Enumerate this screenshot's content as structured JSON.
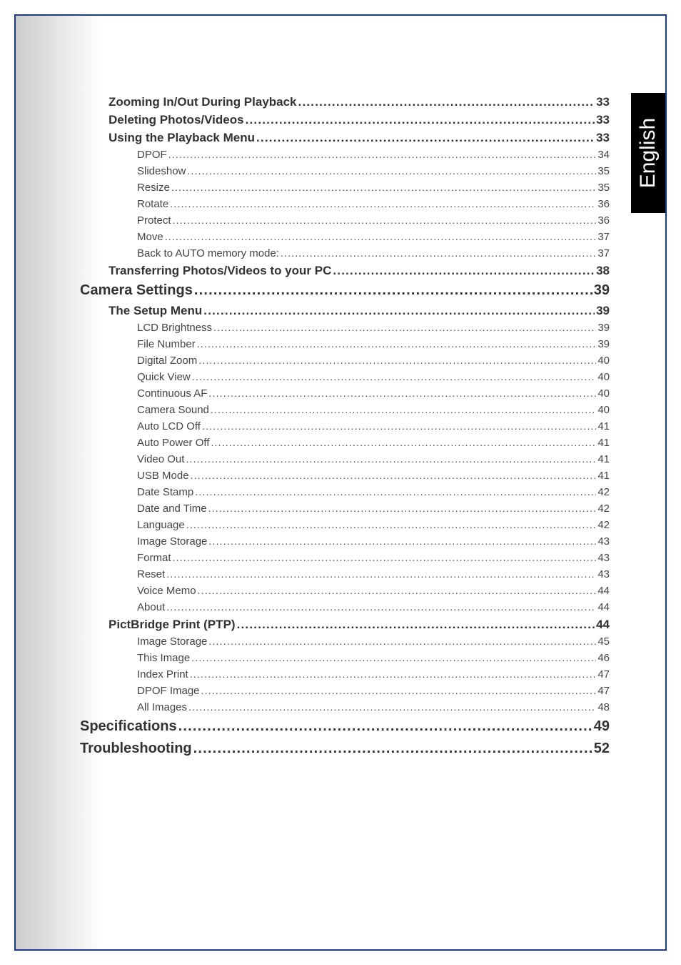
{
  "language_tab": "English",
  "toc": [
    {
      "level": 2,
      "title": "Zooming In/Out During Playback",
      "page": "33"
    },
    {
      "level": 2,
      "title": "Deleting Photos/Videos",
      "page": "33"
    },
    {
      "level": 2,
      "title": "Using the Playback Menu",
      "page": "33"
    },
    {
      "level": 3,
      "title": "DPOF",
      "page": "34"
    },
    {
      "level": 3,
      "title": "Slideshow",
      "page": "35"
    },
    {
      "level": 3,
      "title": "Resize",
      "page": "35"
    },
    {
      "level": 3,
      "title": "Rotate",
      "page": "36"
    },
    {
      "level": 3,
      "title": "Protect",
      "page": "36"
    },
    {
      "level": 3,
      "title": "Move",
      "page": "37"
    },
    {
      "level": 3,
      "title": "Back to AUTO memory mode:",
      "page": "37"
    },
    {
      "level": 2,
      "title": "Transferring Photos/Videos to your PC",
      "page": "38"
    },
    {
      "level": 1,
      "title": "Camera Settings",
      "page": "39"
    },
    {
      "level": 2,
      "title": "The Setup Menu",
      "page": "39"
    },
    {
      "level": 3,
      "title": "LCD Brightness",
      "page": "39"
    },
    {
      "level": 3,
      "title": "File Number",
      "page": "39"
    },
    {
      "level": 3,
      "title": "Digital Zoom",
      "page": "40"
    },
    {
      "level": 3,
      "title": "Quick View",
      "page": "40"
    },
    {
      "level": 3,
      "title": "Continuous AF",
      "page": "40"
    },
    {
      "level": 3,
      "title": "Camera Sound",
      "page": "40"
    },
    {
      "level": 3,
      "title": "Auto LCD Off",
      "page": "41"
    },
    {
      "level": 3,
      "title": "Auto Power Off",
      "page": "41"
    },
    {
      "level": 3,
      "title": "Video Out",
      "page": "41"
    },
    {
      "level": 3,
      "title": "USB Mode",
      "page": "41"
    },
    {
      "level": 3,
      "title": "Date Stamp",
      "page": "42"
    },
    {
      "level": 3,
      "title": "Date and Time",
      "page": "42"
    },
    {
      "level": 3,
      "title": "Language",
      "page": "42"
    },
    {
      "level": 3,
      "title": "Image Storage",
      "page": "43"
    },
    {
      "level": 3,
      "title": "Format",
      "page": "43"
    },
    {
      "level": 3,
      "title": "Reset",
      "page": "43"
    },
    {
      "level": 3,
      "title": "Voice Memo",
      "page": "44"
    },
    {
      "level": 3,
      "title": "About",
      "page": "44"
    },
    {
      "level": 2,
      "title": "PictBridge Print (PTP)",
      "page": "44"
    },
    {
      "level": 3,
      "title": "Image Storage",
      "page": "45"
    },
    {
      "level": 3,
      "title": "This Image",
      "page": "46"
    },
    {
      "level": 3,
      "title": "Index Print",
      "page": "47"
    },
    {
      "level": 3,
      "title": "DPOF Image",
      "page": "47"
    },
    {
      "level": 3,
      "title": "All Images",
      "page": "48"
    },
    {
      "level": 1,
      "title": "Specifications",
      "page": "49"
    },
    {
      "level": 1,
      "title": "Troubleshooting",
      "page": "52"
    }
  ]
}
